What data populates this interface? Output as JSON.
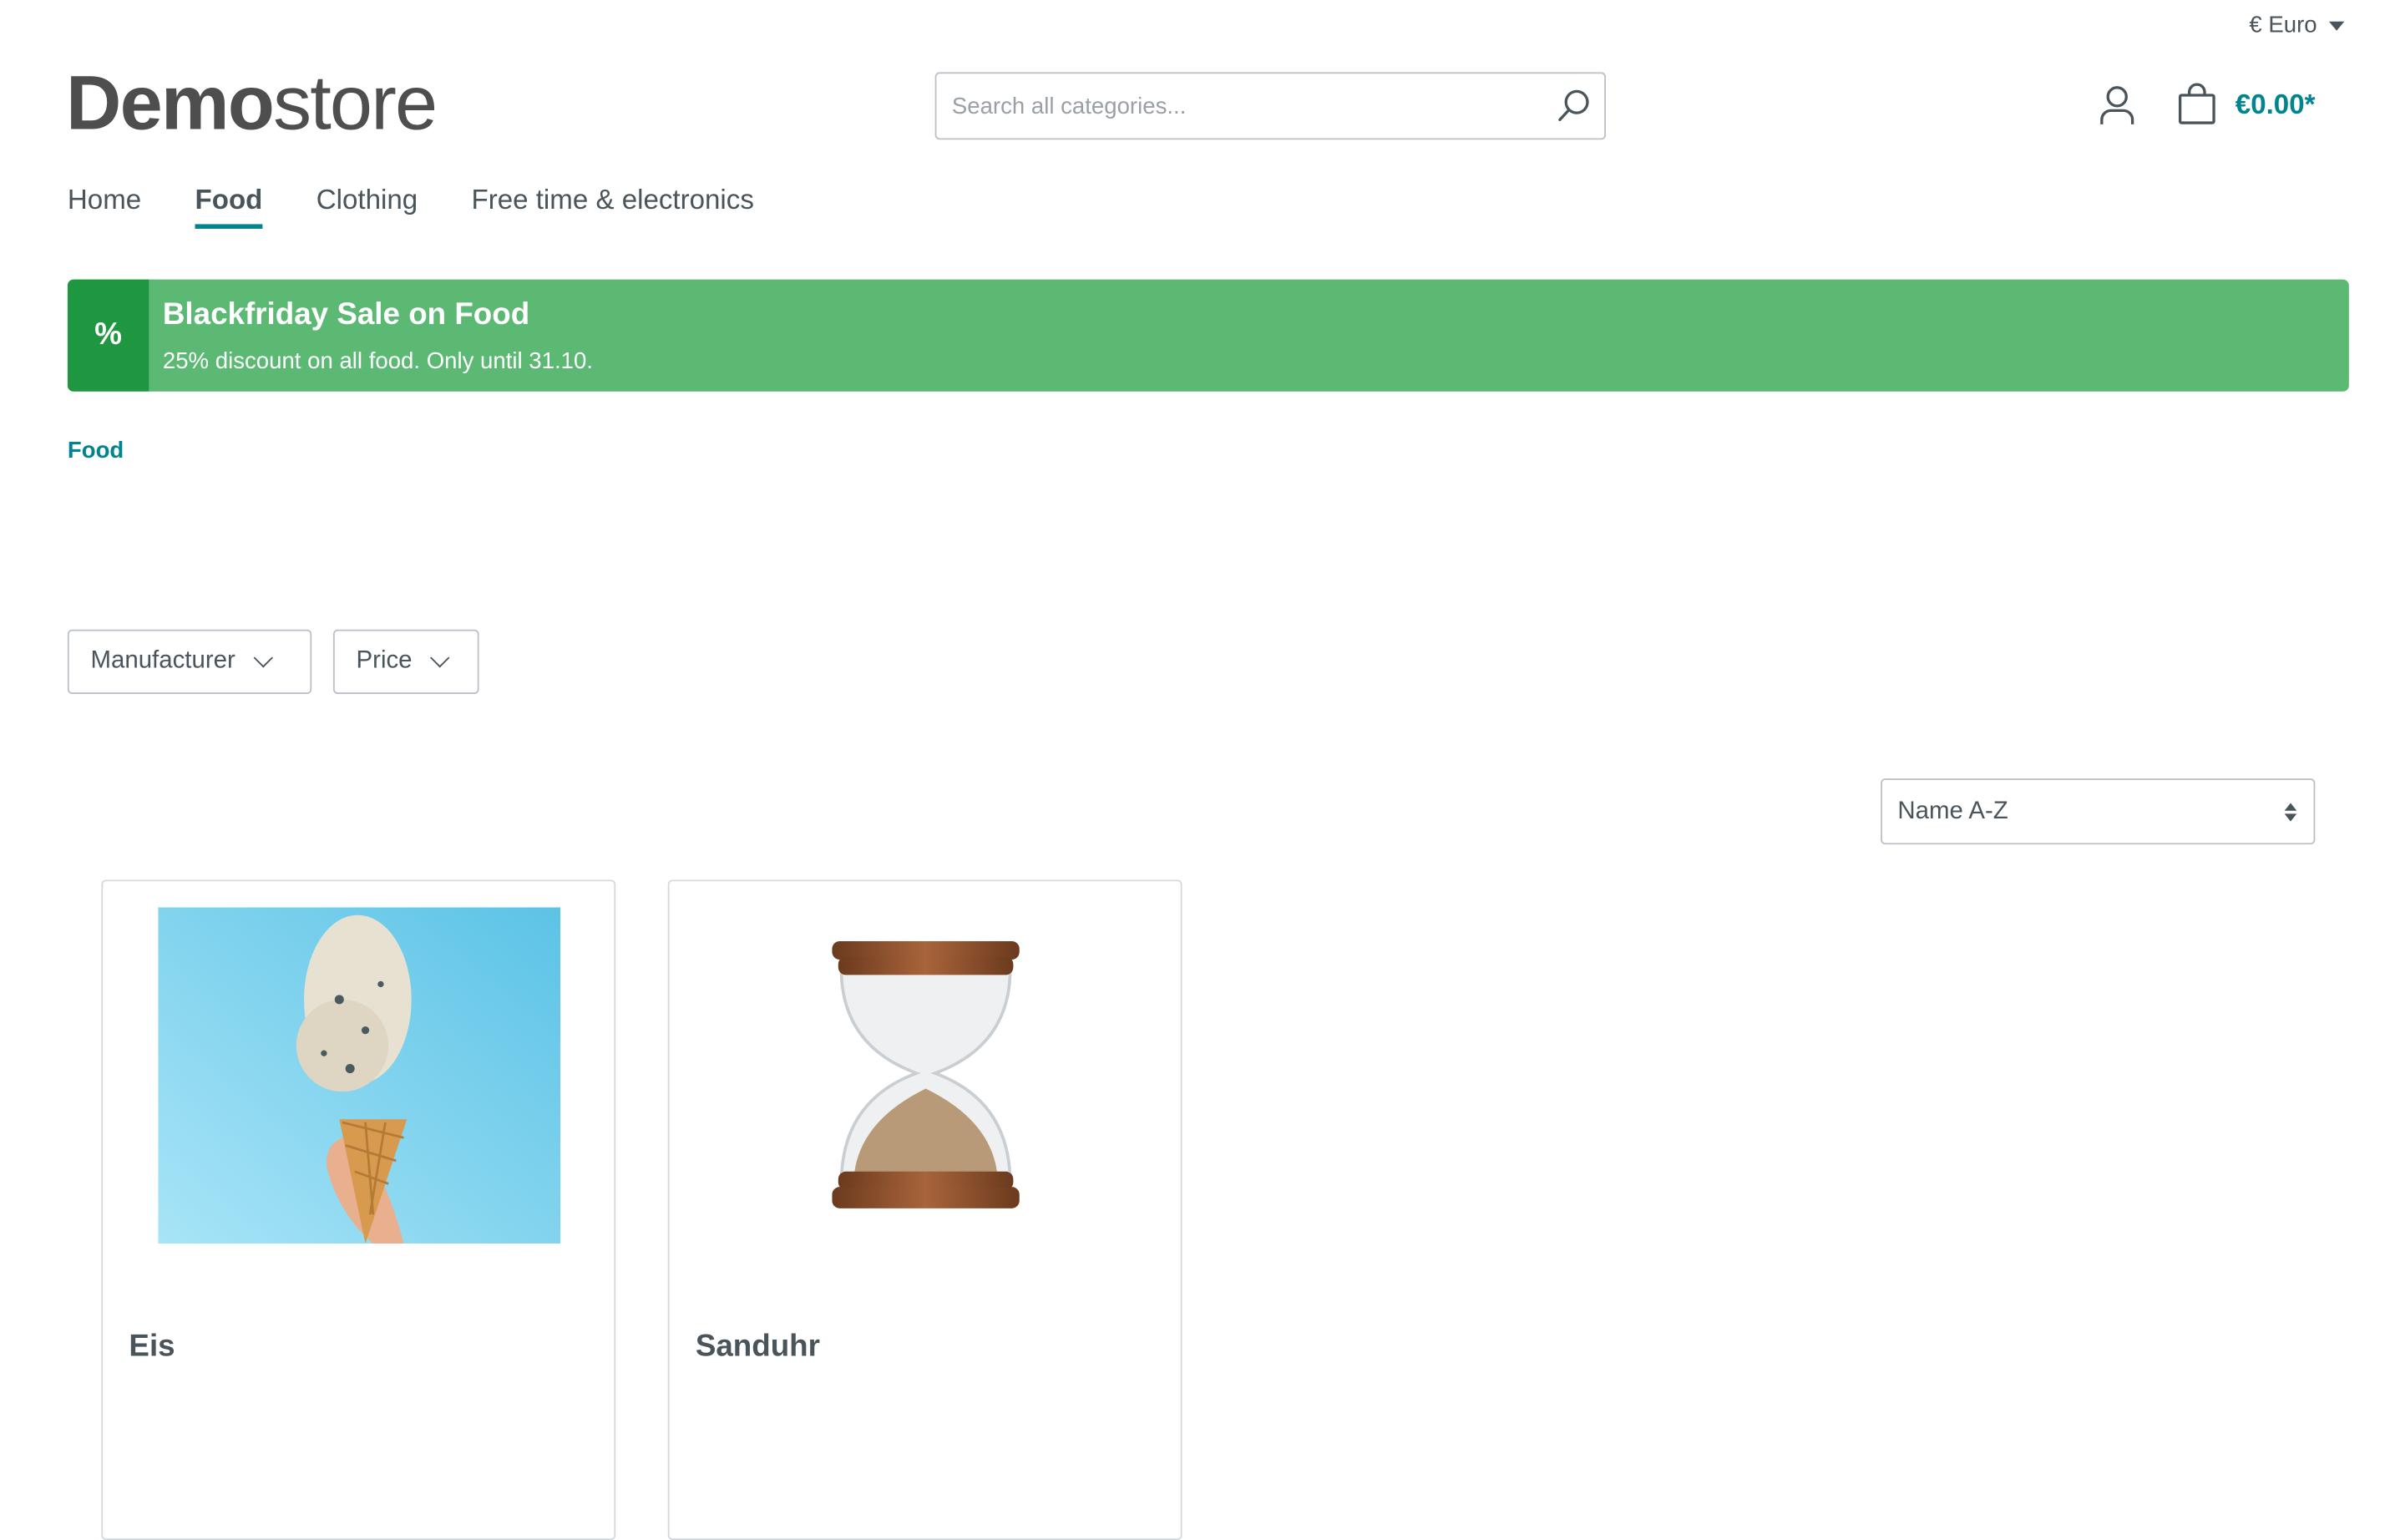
{
  "header": {
    "currency": "€ Euro",
    "logo": {
      "bold": "Demo",
      "light": "store"
    },
    "search": {
      "placeholder": "Search all categories...",
      "value": ""
    },
    "cart_total": "€0.00*",
    "icons": {
      "search": "search-icon",
      "account": "user-icon",
      "cart": "shopping-bag-icon"
    }
  },
  "nav": {
    "items": [
      {
        "label": "Home",
        "active": false
      },
      {
        "label": "Food",
        "active": true
      },
      {
        "label": "Clothing",
        "active": false
      },
      {
        "label": "Free time & electronics",
        "active": false
      }
    ]
  },
  "banner": {
    "icon": "%",
    "title": "Blackfriday Sale on Food",
    "text": "25% discount on all food. Only until 31.10.",
    "colors": {
      "main": "#5cb974",
      "icon_bg": "#1f9740"
    }
  },
  "breadcrumb": [
    "Food"
  ],
  "filters": [
    {
      "label": "Manufacturer"
    },
    {
      "label": "Price"
    }
  ],
  "sorting": {
    "selected": "Name A-Z"
  },
  "products": [
    {
      "name": "Eis",
      "image": "ice-cream-cone"
    },
    {
      "name": "Sanduhr",
      "image": "hourglass"
    }
  ],
  "colors": {
    "accent": "#008490",
    "text": "#4a545b"
  }
}
